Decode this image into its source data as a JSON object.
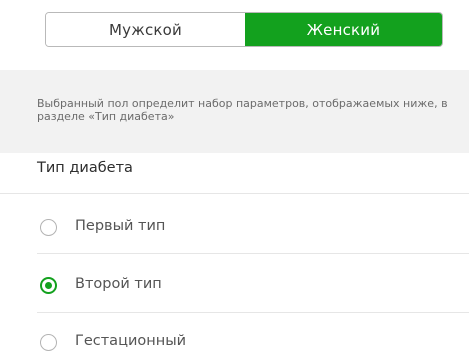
{
  "gender_switch": {
    "options": [
      "Мужской",
      "Женский"
    ],
    "selected": "Женский"
  },
  "hint": "Выбранный пол определит набор параметров, отображаемых ниже, в разделе «Тип диабета»",
  "section": {
    "title": "Тип диабета"
  },
  "diabetes_types": [
    {
      "label": "Первый тип",
      "checked": false
    },
    {
      "label": "Второй тип",
      "checked": true
    },
    {
      "label": "Гестационный",
      "checked": false
    }
  ],
  "colors": {
    "accent": "#13a11e",
    "gray_background": "#f2f2f2"
  }
}
